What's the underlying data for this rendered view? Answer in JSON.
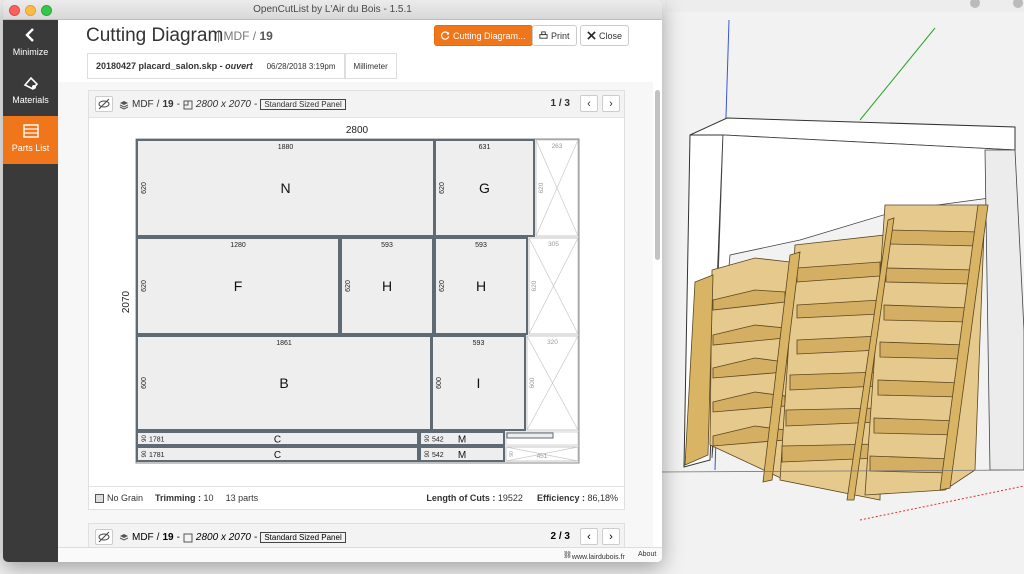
{
  "window": {
    "title": "OpenCutList by L'Air du Bois - 1.5.1"
  },
  "sidebar": {
    "items": [
      {
        "label": "Minimize",
        "icon": "chevron-left-icon"
      },
      {
        "label": "Materials",
        "icon": "materials-icon"
      },
      {
        "label": "Parts List",
        "icon": "parts-list-icon",
        "active": true
      }
    ]
  },
  "header": {
    "title": "Cutting Diagram",
    "subtitle_material": "MDF",
    "subtitle_thickness": "19",
    "buttons": {
      "cutting_diagram": "Cutting Diagram...",
      "print": "Print",
      "close": "Close"
    }
  },
  "file": {
    "name": "20180427 placard_salon.skp",
    "status": "ouvert",
    "date": "06/28/2018 3:19pm",
    "unit": "Millimeter"
  },
  "sheet1": {
    "material": "MDF",
    "thickness": "19",
    "dimensions": "2800 x 2070",
    "type": "Standard Sized Panel",
    "page": "1 / 3",
    "width_label": "2800",
    "height_label": "2070"
  },
  "parts": [
    {
      "label": "N",
      "length": "1880",
      "width": "620"
    },
    {
      "label": "G",
      "length": "631",
      "width": "620"
    },
    {
      "label": "F",
      "length": "1280",
      "width": "620"
    },
    {
      "label": "H",
      "length": "593",
      "width": "620"
    },
    {
      "label": "H",
      "length": "593",
      "width": "620"
    },
    {
      "label": "B",
      "length": "1861",
      "width": "600"
    },
    {
      "label": "I",
      "length": "593",
      "width": "600"
    },
    {
      "label": "C",
      "length": "1781",
      "width": "90"
    },
    {
      "label": "C",
      "length": "1781",
      "width": "90"
    },
    {
      "label": "M",
      "length": "542",
      "width": "90"
    },
    {
      "label": "M",
      "length": "542",
      "width": "90"
    }
  ],
  "offcuts": [
    {
      "length": "263",
      "width": "620"
    },
    {
      "length": "305",
      "width": "620"
    },
    {
      "length": "320",
      "width": "600"
    },
    {
      "length": "451",
      "width": "90"
    }
  ],
  "footer": {
    "grain": "No Grain",
    "trimming_label": "Trimming :",
    "trimming_value": "10",
    "parts_count": "13 parts",
    "cuts_label": "Length of Cuts :",
    "cuts_value": "19522",
    "efficiency_label": "Efficiency :",
    "efficiency_value": "86,18%"
  },
  "sheet2": {
    "material": "MDF",
    "thickness": "19",
    "dimensions": "2800 x 2070",
    "type": "Standard Sized Panel",
    "page": "2 / 3"
  },
  "bottom": {
    "link": "www.lairdubois.fr",
    "about": "About"
  },
  "colors": {
    "accent": "#f0761c",
    "sidebar": "#3a3a3a",
    "part_fill": "#eeeeee",
    "part_border": "#5f6b74",
    "wood": "#c9a45a"
  }
}
